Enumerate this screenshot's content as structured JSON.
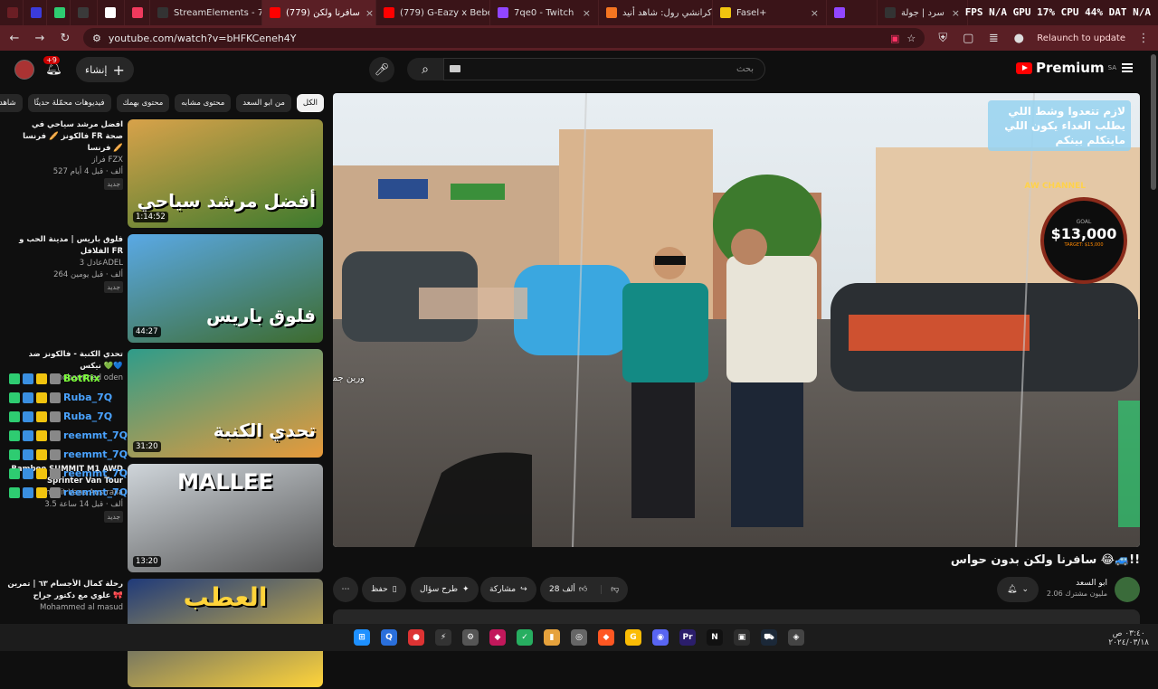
{
  "browser": {
    "tabs": [
      {
        "title": "",
        "color": "#6b1e24"
      },
      {
        "title": "",
        "color": "#3b3bdb"
      },
      {
        "title": "",
        "color": "#2ecc71"
      },
      {
        "title": "",
        "color": "#3a3a3a"
      },
      {
        "title": "",
        "color": "#ffffff"
      },
      {
        "title": "",
        "color": "#ef3a5d"
      },
      {
        "title": "StreamElements - 7q",
        "color": "#333333"
      },
      {
        "title": "(779) سافرنا ولكن",
        "color": "#ff0000",
        "active": true
      },
      {
        "title": "(779) G-Eazy x Bebe R",
        "color": "#ff0000"
      },
      {
        "title": "7qe0 - Twitch",
        "color": "#9146ff"
      },
      {
        "title": "كرانشي رول: شاهد أنيد",
        "color": "#f47521"
      },
      {
        "title": "Fasel+",
        "color": "#f1c40f"
      },
      {
        "title": "",
        "color": "#9146ff"
      },
      {
        "title": "سرد | جولة",
        "color": "#333333"
      }
    ],
    "sys_stats": "FPS N/A  GPU 17%  CPU 44%  DAT N/A",
    "url": "youtube.com/watch?v=bHFKCeneh4Y",
    "relaunch": "Relaunch to update"
  },
  "header": {
    "logo": "Premium",
    "region": "SA",
    "search_placeholder": "بحث",
    "create_label": "إنشاء",
    "notif_count": "+9"
  },
  "chips": [
    "الكل",
    "من ابو السعد",
    "محتوى مشابه",
    "محتوى بهمك",
    "فيديوهات محمّلة حديثًا",
    "شاهدتها"
  ],
  "recs": [
    {
      "title": "افضل مرشد سياحي في فالكونز 🥖 فرنسا FR صحة فرنسا 🥖",
      "channel": "فراز FZX",
      "meta": "527 ألف · قبل 4 أيام",
      "badge": "جديد",
      "duration": "1:14:52",
      "thumb_text": "أفضل مرشد سياحي"
    },
    {
      "title": "فلوق باريس | مدينة الحب و الفلافل FR",
      "channel": "عادل 3ADEL",
      "meta": "264 ألف · قبل يومين",
      "badge": "جديد",
      "duration": "44:27",
      "thumb_text": "فلوق باريس"
    },
    {
      "title": "تحدي الكنبة - فالكونز ضد نيكس 💚💙",
      "channel": "mohammed oden",
      "meta": "",
      "badge": "",
      "duration": "31:20",
      "thumb_text": "تحدي الكنبة"
    },
    {
      "title": "Bamboo SUMMIT M1 AWD Sprinter Van Tour",
      "channel": "Summit Vans Australia",
      "meta": "3.5 ألف · قبل 14 ساعة",
      "badge": "جديد",
      "duration": "13:20",
      "thumb_text": "MALLEE"
    },
    {
      "title": "رحلة كمال الأجسام ٦٣ | تمرين علوي مع دكتور جراح 🎀",
      "channel": "Mohammed al masud",
      "meta": "",
      "badge": "",
      "duration": "",
      "thumb_text": "العطب"
    }
  ],
  "chat_overlay": [
    {
      "name": "BotRix",
      "color": "#7cff3a"
    },
    {
      "name": "Ruba_7Q",
      "color": "#4aa3ff"
    },
    {
      "name": "Ruba_7Q",
      "color": "#4aa3ff"
    },
    {
      "name": "reemmt_7Q",
      "color": "#4aa3ff"
    },
    {
      "name": "reemmt_7Q",
      "color": "#4aa3ff"
    },
    {
      "name": "reemmt_7Q",
      "color": "#4aa3ff"
    },
    {
      "name": "reemmt_7Q",
      "color": "#4aa3ff"
    }
  ],
  "stream_overlay": {
    "caption": "لازم تتعدوا وشط اللي يطلب الغداء يكون اللي مايتكلم بينكم",
    "goal_amount": "$13,000",
    "goal_label": "GOAL",
    "target": "TARGET: $15,000",
    "banner": "AW CHANNEL",
    "chat_text": "ورين جميعًا لا تنسون الاشتراك"
  },
  "video": {
    "title": "سافرنا ولكن بدون حواس 😂🚙!!",
    "channel": "ابو السعد",
    "subscribers": "2.06 مليون مشترك",
    "likes": "28 ألف",
    "share": "مشاركة",
    "ask": "طرح سؤال",
    "save": "حفظ"
  },
  "taskbar": {
    "time": "٠٣:٤٠ ص",
    "date": "٢٠٢٤/٠٣/١٨",
    "apps": [
      "⊞",
      "Q",
      "●",
      "⚡",
      "⚙",
      "◆",
      "✓",
      "▮",
      "◎",
      "◆",
      "G",
      "◉",
      "Pr",
      "N",
      "▣",
      "⛟",
      "◈"
    ]
  }
}
